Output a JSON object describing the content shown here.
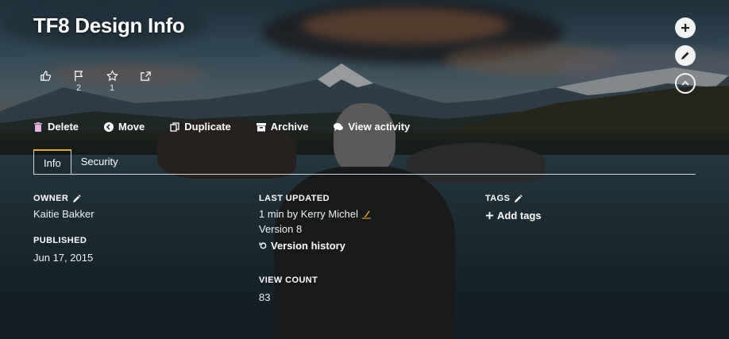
{
  "page": {
    "title": "TF8 Design Info"
  },
  "reactions": [
    {
      "icon": "thumbs-up-icon",
      "count": ""
    },
    {
      "icon": "flag-icon",
      "count": "2"
    },
    {
      "icon": "star-icon",
      "count": "1"
    },
    {
      "icon": "share-icon",
      "count": ""
    }
  ],
  "actions": {
    "delete": "Delete",
    "move": "Move",
    "duplicate": "Duplicate",
    "archive": "Archive",
    "view_activity": "View activity"
  },
  "tabs": {
    "info": "Info",
    "security": "Security"
  },
  "owner": {
    "label": "OWNER",
    "value": "Kaitie Bakker"
  },
  "published": {
    "label": "PUBLISHED",
    "value": "Jun 17, 2015"
  },
  "last_updated": {
    "label": "LAST UPDATED",
    "value": "1 min by Kerry Michel",
    "version": "Version 8",
    "history_link": "Version history"
  },
  "view_count": {
    "label": "VIEW COUNT",
    "value": "83"
  },
  "tags": {
    "label": "TAGS",
    "add_link": "Add tags"
  },
  "side_buttons": [
    "plus-icon",
    "pencil-icon",
    "chevron-up-icon"
  ],
  "colors": {
    "tab_accent": "#e3a33a",
    "delete_icon": "#e6b6de"
  }
}
